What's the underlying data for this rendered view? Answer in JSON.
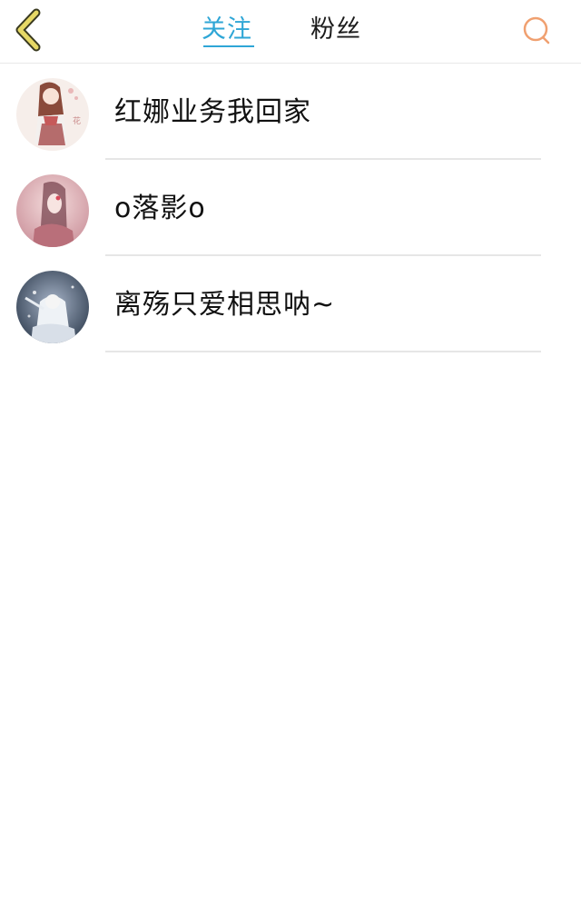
{
  "header": {
    "tabs": [
      {
        "label": "关注",
        "active": true
      },
      {
        "label": "粉丝",
        "active": false
      }
    ],
    "back_icon": "chevron-left-icon",
    "search_icon": "search-icon"
  },
  "colors": {
    "accent": "#2fa6d6",
    "back_icon": "#c9b540",
    "search_icon": "#f0a070",
    "divider": "#e6e6e6"
  },
  "users": [
    {
      "name": "红娜业务我回家"
    },
    {
      "name": "o落影o"
    },
    {
      "name": "离殇只爱相思呐~"
    }
  ]
}
